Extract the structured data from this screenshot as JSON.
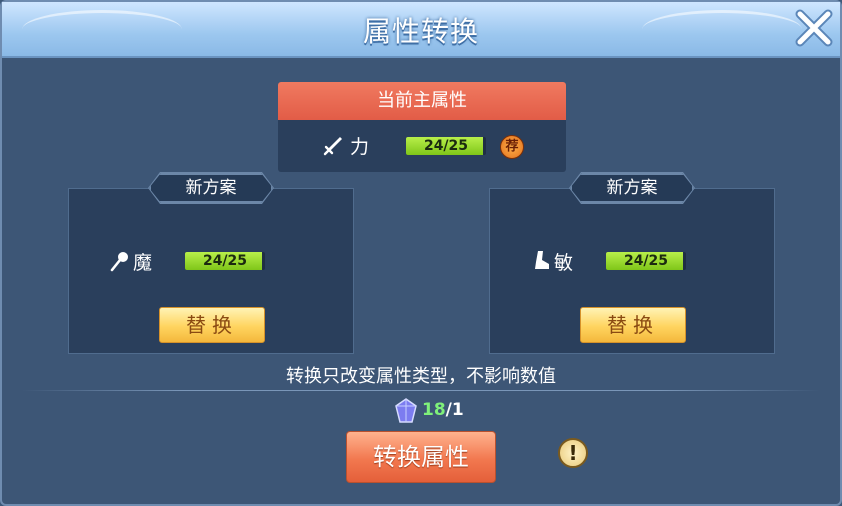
{
  "title": "属性转换",
  "current": {
    "header": "当前主属性",
    "attr_name": "力",
    "icon": "sword-icon",
    "value": "24/25",
    "fill": 0.96,
    "badge": "荐"
  },
  "left_plan": {
    "tab": "新方案",
    "attr_name": "魔",
    "icon": "staff-icon",
    "value": "24/25",
    "fill": 0.96,
    "button": "替换"
  },
  "right_plan": {
    "tab": "新方案",
    "attr_name": "敏",
    "icon": "boot-icon",
    "value": "24/25",
    "fill": 0.96,
    "button": "替换"
  },
  "hint": "转换只改变属性类型，不影响数值",
  "cost": {
    "have": "18",
    "need": "/1",
    "icon": "crystal-icon"
  },
  "convert_button": "转换属性",
  "colors": {
    "accent_green": "#7fc619",
    "header_red": "#e25c47",
    "button_orange": "#f2784f"
  }
}
